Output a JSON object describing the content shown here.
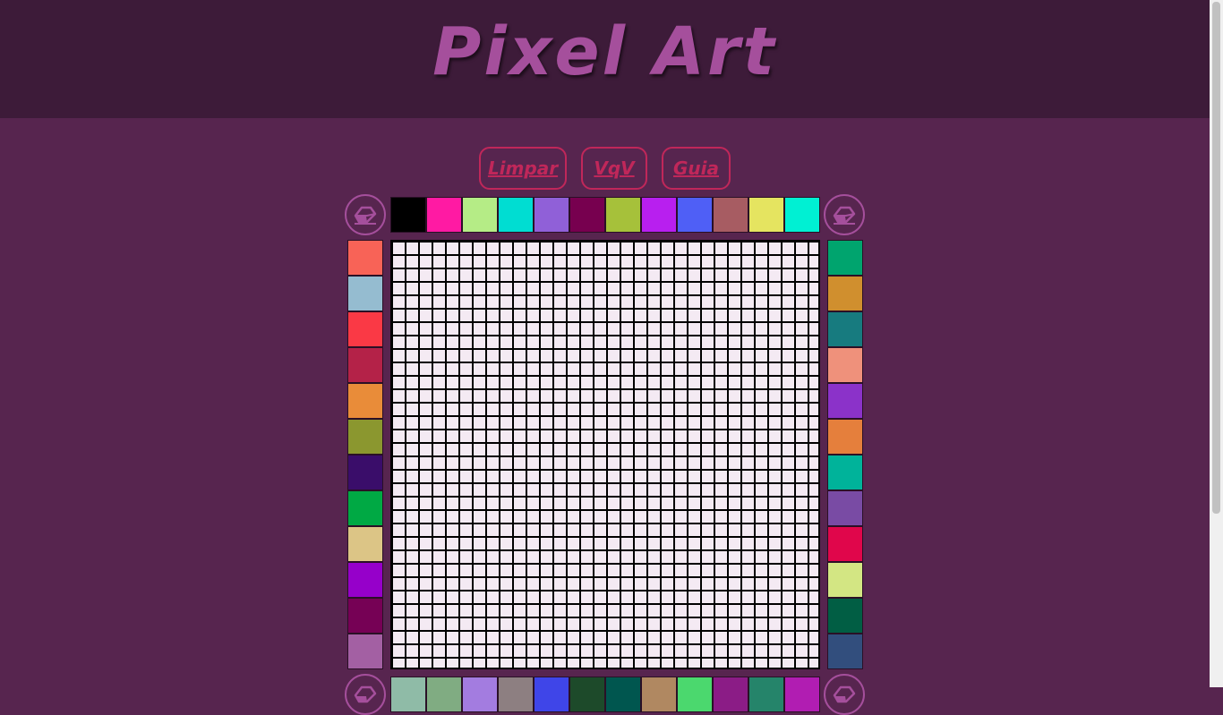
{
  "header": {
    "title": "Pixel Art"
  },
  "buttons": {
    "clear": "Limpar",
    "vqv": "VqV",
    "guide": "Guia"
  },
  "board": {
    "cols": 32,
    "rows": 32,
    "cell_color": "#f4eaf3",
    "grid_color": "#000000"
  },
  "palettes": {
    "top": [
      "#000000",
      "#ff1aa3",
      "#b5ec86",
      "#00ddd2",
      "#9060d8",
      "#77004f",
      "#a6c13a",
      "#b81fef",
      "#4f5ff6",
      "#a75c62",
      "#e5e460",
      "#00f0d3"
    ],
    "left": [
      "#f86357",
      "#95bcd0",
      "#fa3945",
      "#b42248",
      "#e98c39",
      "#8b972f",
      "#3a0d6a",
      "#00a944",
      "#dcc586",
      "#9600ca",
      "#760155",
      "#a360a3"
    ],
    "right": [
      "#00a46e",
      "#d08f2e",
      "#177b7f",
      "#ef917b",
      "#8b32c9",
      "#e57f3c",
      "#00b39a",
      "#794ba4",
      "#e0064b",
      "#d3e683",
      "#015e44",
      "#324e7d"
    ],
    "bottom": [
      "#8fbba7",
      "#80ac82",
      "#a37ce0",
      "#8d7f81",
      "#3f45e8",
      "#1d4a2a",
      "#00564f",
      "#b08861",
      "#4bd86e",
      "#8b1c86",
      "#25846a",
      "#b11db2"
    ]
  },
  "icons": {
    "eraser": "eraser-icon"
  }
}
